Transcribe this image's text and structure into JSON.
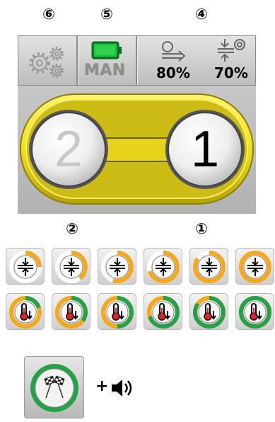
{
  "callouts": {
    "settings": "⑥",
    "battery": "⑤",
    "metrics": "④",
    "indicator_two": "②",
    "indicator_one": "①"
  },
  "status_bar": {
    "mode_label": "MAN",
    "metric_left_value": "80%",
    "metric_right_value": "70%"
  },
  "indicators": {
    "left_label": "2",
    "right_label": "1"
  },
  "compression_progress": [
    0.25,
    0.4,
    0.55,
    0.7,
    0.85,
    1.0
  ],
  "temperature_progress": [
    0.2,
    0.35,
    0.5,
    0.7,
    0.85,
    1.0
  ],
  "finish": {
    "plus_label": "+"
  },
  "colors": {
    "yellow": "#f4e11a",
    "orange": "#f4a81c",
    "green": "#27a04a",
    "battery_green": "#1cbf3a"
  }
}
